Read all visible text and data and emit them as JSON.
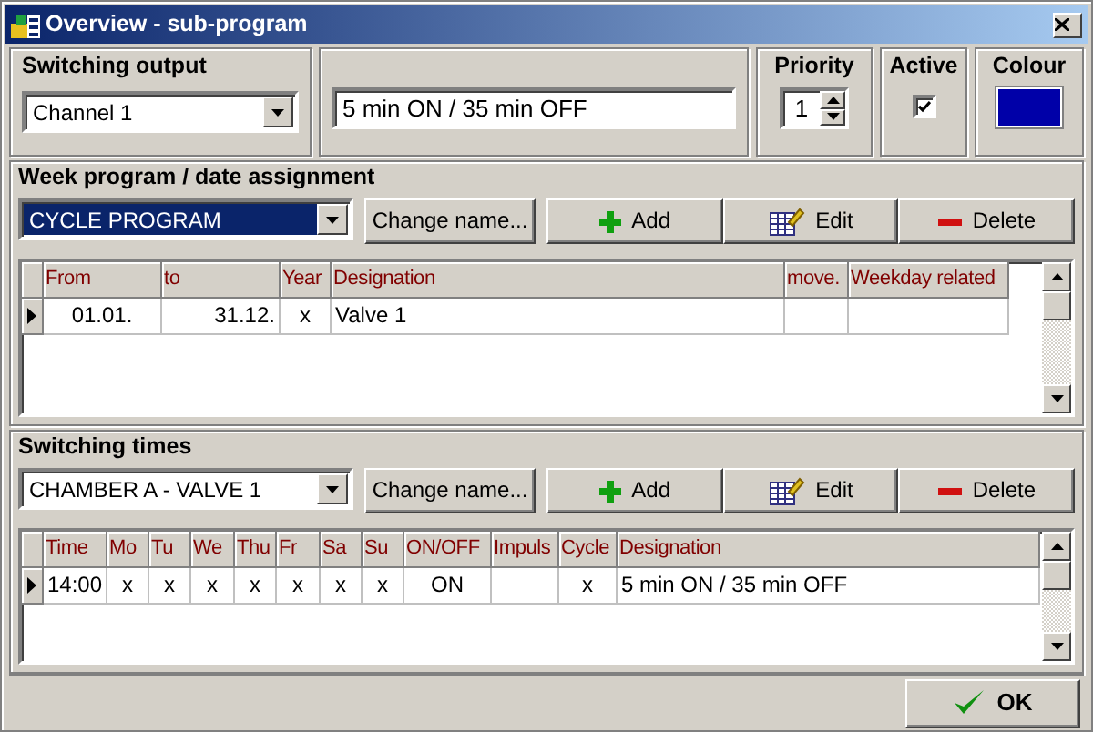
{
  "window": {
    "title": "Overview - sub-program"
  },
  "switching_output": {
    "label": "Switching output",
    "value": "Channel 1"
  },
  "description": {
    "value": "5 min ON / 35 min OFF"
  },
  "priority": {
    "label": "Priority",
    "value": "1"
  },
  "active": {
    "label": "Active",
    "checked": true
  },
  "colour": {
    "label": "Colour",
    "color": "#0000a8"
  },
  "week_program": {
    "label": "Week program / date assignment",
    "selection": {
      "value": "CYCLE PROGRAM",
      "highlighted": true
    },
    "buttons": [
      {
        "kind": "rename",
        "label": "Change name..."
      },
      {
        "kind": "add",
        "label": "Add"
      },
      {
        "kind": "edit",
        "label": "Edit"
      },
      {
        "kind": "delete",
        "label": "Delete"
      }
    ],
    "table": {
      "columns": [
        "From",
        "to",
        "Year",
        "Designation",
        "move.",
        "Weekday related"
      ],
      "rows": [
        {
          "selected": true,
          "cells": [
            "01.01.",
            "31.12.",
            "x",
            "Valve 1",
            "",
            ""
          ]
        }
      ]
    }
  },
  "switching_times": {
    "label": "Switching times",
    "selection": {
      "value": "CHAMBER A - VALVE 1",
      "highlighted": false
    },
    "buttons": [
      {
        "kind": "rename",
        "label": "Change name..."
      },
      {
        "kind": "add",
        "label": "Add"
      },
      {
        "kind": "edit",
        "label": "Edit"
      },
      {
        "kind": "delete",
        "label": "Delete"
      }
    ],
    "table": {
      "columns": [
        "Time",
        "Mo",
        "Tu",
        "We",
        "Thu",
        "Fr",
        "Sa",
        "Su",
        "ON/OFF",
        "Impuls",
        "Cycle",
        "Designation"
      ],
      "rows": [
        {
          "selected": true,
          "cells": [
            "14:00",
            "x",
            "x",
            "x",
            "x",
            "x",
            "x",
            "x",
            "ON",
            "",
            "x",
            "5 min ON / 35 min OFF"
          ]
        }
      ]
    }
  },
  "ok_button": {
    "label": "OK"
  }
}
